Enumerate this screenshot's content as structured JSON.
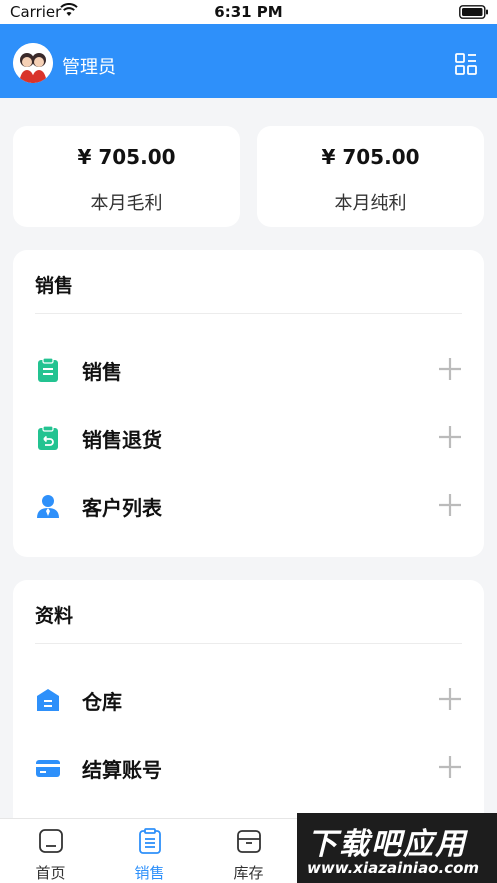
{
  "status_bar": {
    "carrier": "Carrier",
    "time": "6:31 PM"
  },
  "header": {
    "user_name": "管理员",
    "grid_icon": "grid-menu-icon",
    "accent": "#2e90fa"
  },
  "summary": [
    {
      "amount": "¥ 705.00",
      "label": "本月毛利"
    },
    {
      "amount": "¥ 705.00",
      "label": "本月纯利"
    }
  ],
  "sections": [
    {
      "title": "销售",
      "items": [
        {
          "label": "销售",
          "icon": "clipboard-list-icon",
          "color": "#23c391"
        },
        {
          "label": "销售退货",
          "icon": "clipboard-return-icon",
          "color": "#23c391"
        },
        {
          "label": "客户列表",
          "icon": "customer-icon",
          "color": "#2e90fa"
        }
      ]
    },
    {
      "title": "资料",
      "items": [
        {
          "label": "仓库",
          "icon": "warehouse-icon",
          "color": "#2e90fa"
        },
        {
          "label": "结算账号",
          "icon": "card-icon",
          "color": "#2e90fa"
        }
      ]
    }
  ],
  "tabs": [
    {
      "label": "首页",
      "icon": "home-icon",
      "active": false
    },
    {
      "label": "销售",
      "icon": "sales-doc-icon",
      "active": true
    },
    {
      "label": "库存",
      "icon": "inventory-box-icon",
      "active": false
    }
  ],
  "watermark": {
    "main": "下载吧应用",
    "url": "www.xiazainiao.com"
  }
}
